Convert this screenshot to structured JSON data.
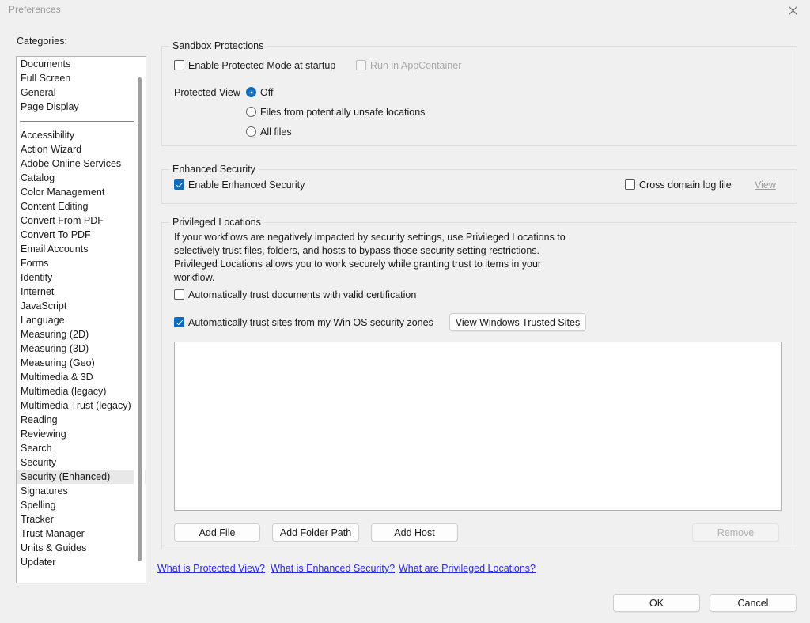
{
  "window": {
    "title": "Preferences",
    "close_icon": "close-icon"
  },
  "sidebar": {
    "label": "Categories:",
    "selected": "Security (Enhanced)",
    "items_top": [
      "Documents",
      "Full Screen",
      "General",
      "Page Display"
    ],
    "items_bottom": [
      "Accessibility",
      "Action Wizard",
      "Adobe Online Services",
      "Catalog",
      "Color Management",
      "Content Editing",
      "Convert From PDF",
      "Convert To PDF",
      "Email Accounts",
      "Forms",
      "Identity",
      "Internet",
      "JavaScript",
      "Language",
      "Measuring (2D)",
      "Measuring (3D)",
      "Measuring (Geo)",
      "Multimedia & 3D",
      "Multimedia (legacy)",
      "Multimedia Trust (legacy)",
      "Reading",
      "Reviewing",
      "Search",
      "Security",
      "Security (Enhanced)",
      "Signatures",
      "Spelling",
      "Tracker",
      "Trust Manager",
      "Units & Guides",
      "Updater"
    ]
  },
  "sandbox": {
    "group_title": "Sandbox Protections",
    "enable_protected_mode": {
      "label": "Enable Protected Mode at startup",
      "checked": false,
      "enabled": true
    },
    "run_in_appcontainer": {
      "label": "Run in AppContainer",
      "checked": false,
      "enabled": false
    },
    "protected_view_label": "Protected View",
    "protected_view_options": [
      {
        "label": "Off",
        "selected": true
      },
      {
        "label": "Files from potentially unsafe locations",
        "selected": false
      },
      {
        "label": "All files",
        "selected": false
      }
    ]
  },
  "enhanced_security": {
    "group_title": "Enhanced Security",
    "enable": {
      "label": "Enable Enhanced Security",
      "checked": true
    },
    "cross_domain_log": {
      "label": "Cross domain log file",
      "checked": false
    },
    "view_link": "View"
  },
  "privileged_locations": {
    "group_title": "Privileged Locations",
    "description": "If your workflows are negatively impacted by security settings, use Privileged Locations to selectively trust files, folders, and hosts to bypass those security setting restrictions. Privileged Locations allows you to work securely while granting trust to items in your workflow.",
    "auto_trust_documents": {
      "label": "Automatically trust documents with valid certification",
      "checked": false
    },
    "auto_trust_sites": {
      "label": "Automatically trust sites from my Win OS security zones",
      "checked": true
    },
    "view_windows_trusted_sites": "View Windows Trusted Sites",
    "locations": [],
    "add_file": "Add File",
    "add_folder_path": "Add Folder Path",
    "add_host": "Add Host",
    "remove": "Remove",
    "remove_enabled": false
  },
  "help_links": [
    "What is Protected View?",
    "What is Enhanced Security?",
    "What are Privileged Locations?"
  ],
  "footer": {
    "ok": "OK",
    "cancel": "Cancel"
  },
  "colors": {
    "accent": "#0f6cbd",
    "link": "#2a2ae0",
    "separator": "#4a90d9",
    "background": "#f0f0f0"
  }
}
